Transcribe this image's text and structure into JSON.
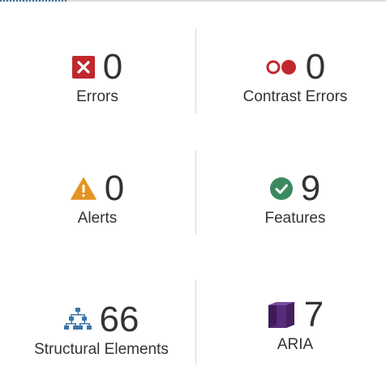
{
  "colors": {
    "error": "#c0282d",
    "contrast": "#c0282d",
    "alert": "#e39424",
    "feature": "#3b8a5f",
    "structure": "#3a76a8",
    "aria": "#5a2a7d"
  },
  "summary": {
    "errors": {
      "count": "0",
      "label": "Errors",
      "icon": "error-x-icon"
    },
    "contrast": {
      "count": "0",
      "label": "Contrast Errors",
      "icon": "contrast-icon"
    },
    "alerts": {
      "count": "0",
      "label": "Alerts",
      "icon": "warning-triangle-icon"
    },
    "features": {
      "count": "9",
      "label": "Features",
      "icon": "check-circle-icon"
    },
    "structural": {
      "count": "66",
      "label": "Structural Elements",
      "icon": "hierarchy-icon"
    },
    "aria": {
      "count": "7",
      "label": "ARIA",
      "icon": "aria-cube-icon"
    }
  }
}
